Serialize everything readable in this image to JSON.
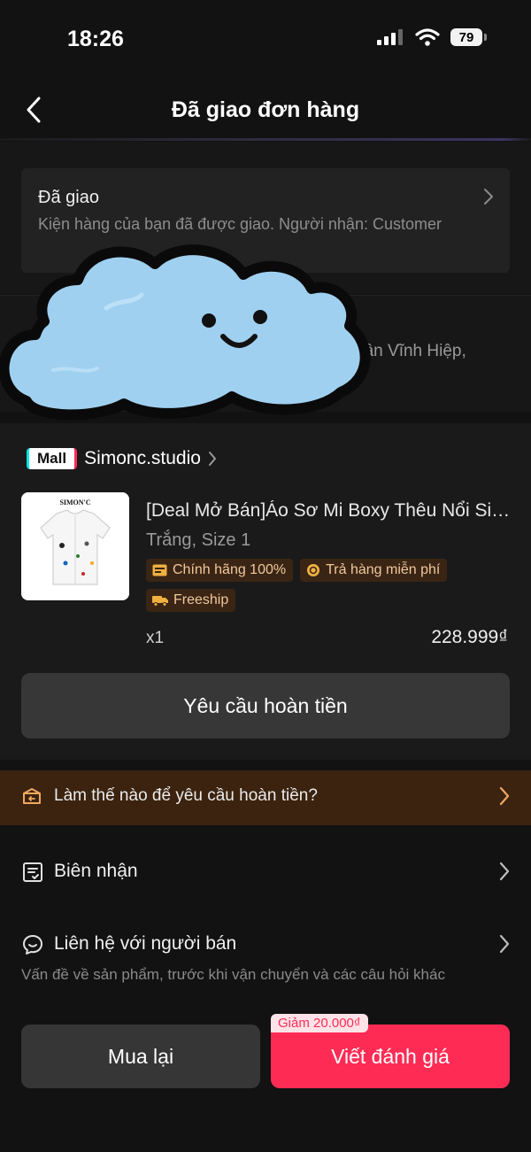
{
  "status_bar": {
    "time": "18:26",
    "battery": "79"
  },
  "header": {
    "title": "Đã giao đơn hàng"
  },
  "delivery": {
    "title": "Đã giao",
    "description": "Kiện hàng của bạn đã được giao. Người nhận: Customer"
  },
  "address": {
    "partial_text": "Tân Vĩnh Hiệp,"
  },
  "shop": {
    "badge": "Mall",
    "name": "Simonc.studio"
  },
  "product": {
    "thumb_brand": "SIMON'C",
    "title": "[Deal Mở Bán]Áo Sơ Mi Boxy Thêu Nổi Simon'C",
    "variant": "Trắng, Size 1",
    "tags": [
      {
        "label": "Chính hãng 100%",
        "icon": "authentic-icon"
      },
      {
        "label": "Trả hàng miễn phí",
        "icon": "free-return-icon"
      },
      {
        "label": "Freeship",
        "icon": "truck-icon"
      }
    ],
    "quantity": "x1",
    "price": "228.999₫"
  },
  "actions": {
    "refund_request": "Yêu cầu hoàn tiền",
    "buy_again": "Mua lại",
    "write_review": "Viết đánh giá",
    "review_discount": "Giảm 20.000₫"
  },
  "help": {
    "text": "Làm thế nào để yêu cầu hoàn tiền?"
  },
  "receipt": {
    "label": "Biên nhận"
  },
  "contact": {
    "label": "Liên hệ với người bán",
    "subtitle": "Vấn đề về sản phẩm, trước khi vận chuyển và các câu hỏi khác"
  },
  "colors": {
    "accent": "#fe2c55",
    "banner": "#3b230f",
    "tag_text": "#f0c89a"
  }
}
